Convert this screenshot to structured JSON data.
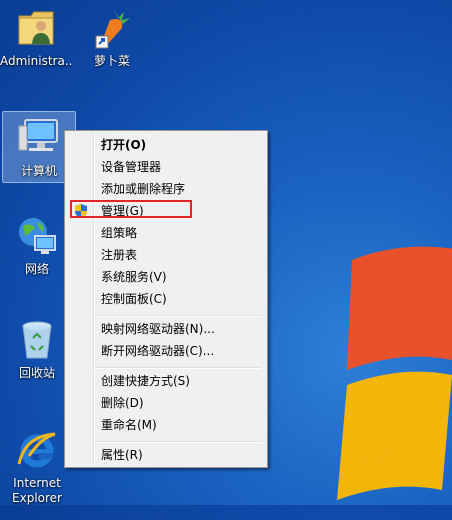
{
  "desktop": {
    "icons": [
      {
        "label": "Administra...",
        "icon": "user-folder-icon"
      },
      {
        "label": "萝卜菜",
        "icon": "carrot-shortcut-icon"
      },
      {
        "label": "计算机",
        "icon": "computer-icon"
      },
      {
        "label": "网络",
        "icon": "network-icon"
      },
      {
        "label": "回收站",
        "icon": "recycle-bin-icon"
      },
      {
        "label_line1": "Internet",
        "label_line2": "Explorer",
        "icon": "internet-explorer-icon"
      }
    ]
  },
  "context_menu": {
    "items": [
      {
        "label": "打开(O)",
        "bold": true
      },
      {
        "label": "设备管理器"
      },
      {
        "label": "添加或删除程序"
      },
      {
        "label": "管理(G)",
        "icon": "uac-shield-icon",
        "highlighted": true
      },
      {
        "label": "组策略"
      },
      {
        "label": "注册表"
      },
      {
        "label": "系统服务(V)"
      },
      {
        "label": "控制面板(C)"
      },
      {
        "label": "映射网络驱动器(N)..."
      },
      {
        "label": "断开网络驱动器(C)..."
      },
      {
        "label": "创建快捷方式(S)"
      },
      {
        "label": "删除(D)"
      },
      {
        "label": "重命名(M)"
      },
      {
        "label": "属性(R)"
      }
    ]
  },
  "colors": {
    "highlight_border": "#e0262b",
    "menu_bg": "#f0f0f0",
    "desktop_bg": "#1a62c2"
  }
}
